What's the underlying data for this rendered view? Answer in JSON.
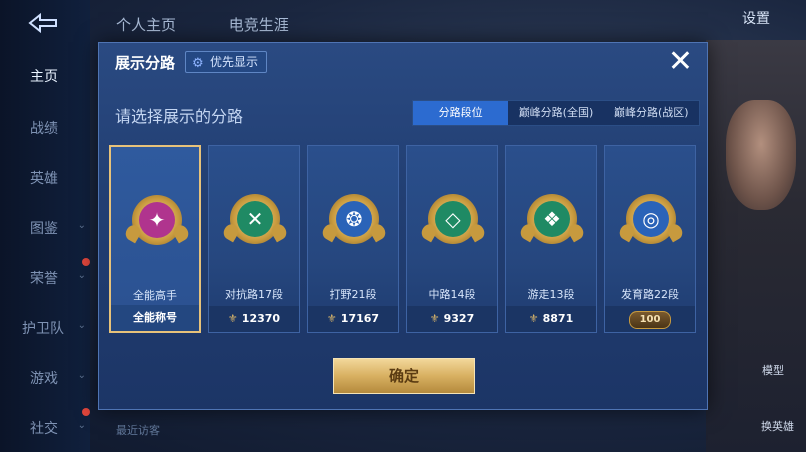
{
  "background": {
    "top_tabs": [
      "个人主页",
      "电竞生涯"
    ],
    "settings_label": "设置",
    "sidebar_items": [
      {
        "label": "主页",
        "active": true
      },
      {
        "label": "战绩"
      },
      {
        "label": "英雄"
      },
      {
        "label": "图鉴",
        "chevron": true
      },
      {
        "label": "荣誉",
        "chevron": true
      },
      {
        "label": "护卫队",
        "chevron": true
      },
      {
        "label": "游戏",
        "chevron": true
      },
      {
        "label": "社交",
        "chevron": true
      }
    ],
    "recent_visit_label": "最近访客",
    "model_label": "模型",
    "switch_hero_label": "换英雄"
  },
  "modal": {
    "title": "展示分路",
    "pref_button_label": "优先显示",
    "close_icon": "close-icon",
    "subtitle": "请选择展示的分路",
    "segments": [
      {
        "label": "分路段位",
        "active": true
      },
      {
        "label": "巅峰分路(全国)"
      },
      {
        "label": "巅峰分路(战区)"
      }
    ],
    "cards": [
      {
        "label": "全能高手",
        "footer": "全能称号",
        "color": "#b0348e",
        "icon": "✦",
        "selected": true
      },
      {
        "label": "对抗路17段",
        "footer": "12370",
        "color": "#1f8a64",
        "icon": "✕"
      },
      {
        "label": "打野21段",
        "footer": "17167",
        "color": "#2a63b8",
        "icon": "❂"
      },
      {
        "label": "中路14段",
        "footer": "9327",
        "color": "#1f8a64",
        "icon": "◇"
      },
      {
        "label": "游走13段",
        "footer": "8871",
        "color": "#1f8a64",
        "icon": "❖"
      },
      {
        "label": "发育路22段",
        "footer": "100",
        "color": "#2a63b8",
        "icon": "◎",
        "badge": true
      }
    ],
    "confirm_label": "确定"
  }
}
